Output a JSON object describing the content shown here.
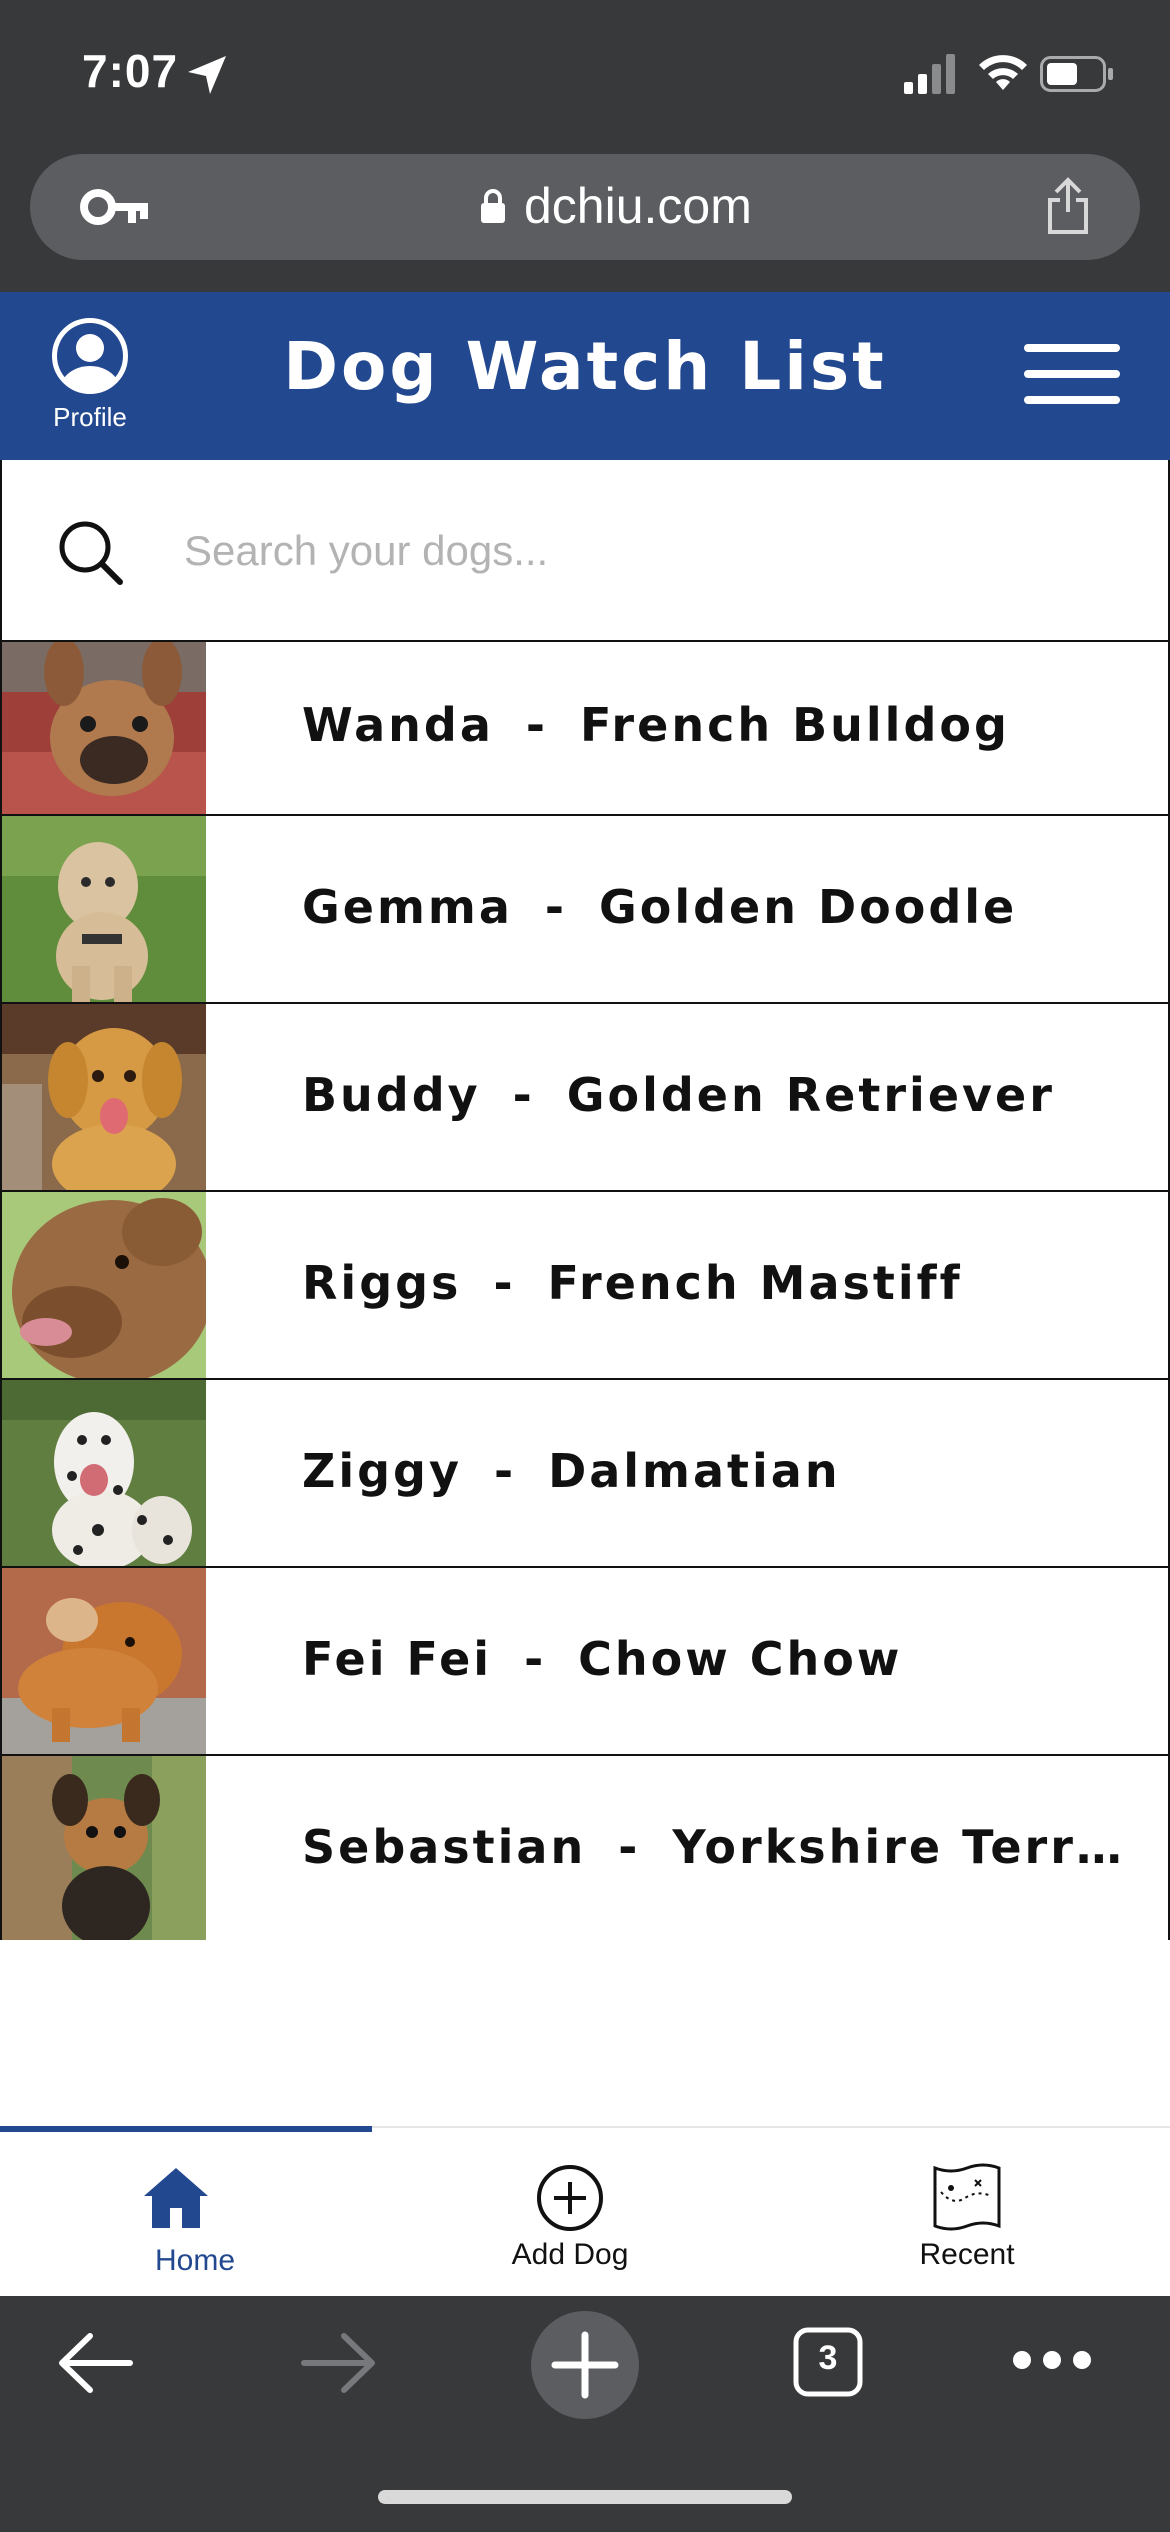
{
  "status_bar": {
    "time": "7:07"
  },
  "browser": {
    "url": "dchiu.com",
    "tab_count": "3"
  },
  "header": {
    "title": "Dog Watch List",
    "profile_label": "Profile"
  },
  "search": {
    "placeholder": "Search your dogs..."
  },
  "dogs": [
    {
      "name": "Wanda",
      "breed": "French Bulldog"
    },
    {
      "name": "Gemma",
      "breed": "Golden Doodle"
    },
    {
      "name": "Buddy",
      "breed": "Golden Retriever"
    },
    {
      "name": "Riggs",
      "breed": "French Mastiff"
    },
    {
      "name": "Ziggy",
      "breed": "Dalmatian"
    },
    {
      "name": "Fei Fei",
      "breed": "Chow Chow"
    },
    {
      "name": "Sebastian",
      "breed": "Yorkshire Terr…"
    }
  ],
  "separator": "-",
  "tabs": [
    {
      "label": "Home",
      "icon": "home-icon",
      "active": true
    },
    {
      "label": "Add Dog",
      "icon": "add-circle-icon",
      "active": false
    },
    {
      "label": "Recent",
      "icon": "map-icon",
      "active": false
    }
  ],
  "colors": {
    "brand_blue": "#22488f",
    "chrome_dark": "#38393b"
  }
}
